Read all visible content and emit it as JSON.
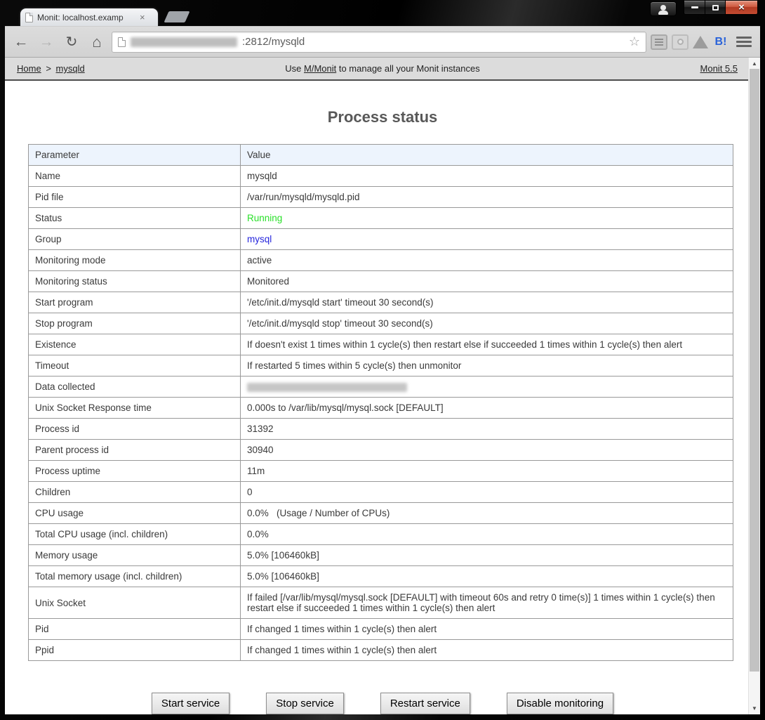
{
  "browser": {
    "tab_title": "Monit: localhost.examp",
    "address_visible": ":2812/mysqld",
    "icons": {
      "close_tab": "×",
      "back": "←",
      "forward": "→",
      "reload": "↻",
      "home": "⌂",
      "star": "☆",
      "hatena": "B!",
      "scroll_up": "▲",
      "scroll_down": "▼"
    },
    "extension_icons": [
      "notes-extension-icon",
      "camera-extension-icon",
      "drive-extension-icon",
      "hatena-bookmark-icon"
    ],
    "window_controls": [
      "profile",
      "minimize",
      "maximize",
      "close"
    ]
  },
  "header": {
    "breadcrumb": {
      "home": "Home",
      "separator": ">",
      "current": "mysqld"
    },
    "center": {
      "prefix": "Use ",
      "link": "M/Monit",
      "suffix": " to manage all your Monit instances"
    },
    "version": "Monit 5.5"
  },
  "page": {
    "title": "Process status"
  },
  "table": {
    "headers": [
      "Parameter",
      "Value"
    ],
    "rows": [
      {
        "param": "Name",
        "value": "mysqld"
      },
      {
        "param": "Pid file",
        "value": "/var/run/mysqld/mysqld.pid"
      },
      {
        "param": "Status",
        "value": "Running",
        "style": "status-ok"
      },
      {
        "param": "Group",
        "value": "mysql",
        "style": "link"
      },
      {
        "param": "Monitoring mode",
        "value": "active"
      },
      {
        "param": "Monitoring status",
        "value": "Monitored"
      },
      {
        "param": "Start program",
        "value": "'/etc/init.d/mysqld start' timeout 30 second(s)"
      },
      {
        "param": "Stop program",
        "value": "'/etc/init.d/mysqld stop' timeout 30 second(s)"
      },
      {
        "param": "Existence",
        "value": "If doesn't exist 1 times within 1 cycle(s) then restart else if succeeded 1 times within 1 cycle(s) then alert"
      },
      {
        "param": "Timeout",
        "value": "If restarted 5 times within 5 cycle(s) then unmonitor"
      },
      {
        "param": "Data collected",
        "value": "",
        "style": "redacted"
      },
      {
        "param": "Unix Socket Response time",
        "value": "0.000s to /var/lib/mysql/mysql.sock [DEFAULT]"
      },
      {
        "param": "Process id",
        "value": "31392"
      },
      {
        "param": "Parent process id",
        "value": "30940"
      },
      {
        "param": "Process uptime",
        "value": "11m"
      },
      {
        "param": "Children",
        "value": "0"
      },
      {
        "param": "CPU usage",
        "value": "0.0%   (Usage / Number of CPUs)"
      },
      {
        "param": "Total CPU usage (incl. children)",
        "value": "0.0%"
      },
      {
        "param": "Memory usage",
        "value": "5.0% [106460kB]"
      },
      {
        "param": "Total memory usage (incl. children)",
        "value": "5.0% [106460kB]"
      },
      {
        "param": "Unix Socket",
        "value": "If failed [/var/lib/mysql/mysql.sock [DEFAULT] with timeout 60s and retry 0 time(s)] 1 times within 1 cycle(s) then restart else if succeeded 1 times within 1 cycle(s) then alert"
      },
      {
        "param": "Pid",
        "value": "If changed 1 times within 1 cycle(s) then alert"
      },
      {
        "param": "Ppid",
        "value": "If changed 1 times within 1 cycle(s) then alert"
      }
    ]
  },
  "actions": [
    {
      "label": "Start service",
      "name": "start-service-button"
    },
    {
      "label": "Stop service",
      "name": "stop-service-button"
    },
    {
      "label": "Restart service",
      "name": "restart-service-button"
    },
    {
      "label": "Disable monitoring",
      "name": "disable-monitoring-button"
    }
  ],
  "colors": {
    "status_ok_green": "#2ae02a",
    "group_link_blue": "#2525dd",
    "table_header_bg": "#edf4fd",
    "hatena_blue": "#2a63d9",
    "close_button_red": "#c34b31"
  }
}
